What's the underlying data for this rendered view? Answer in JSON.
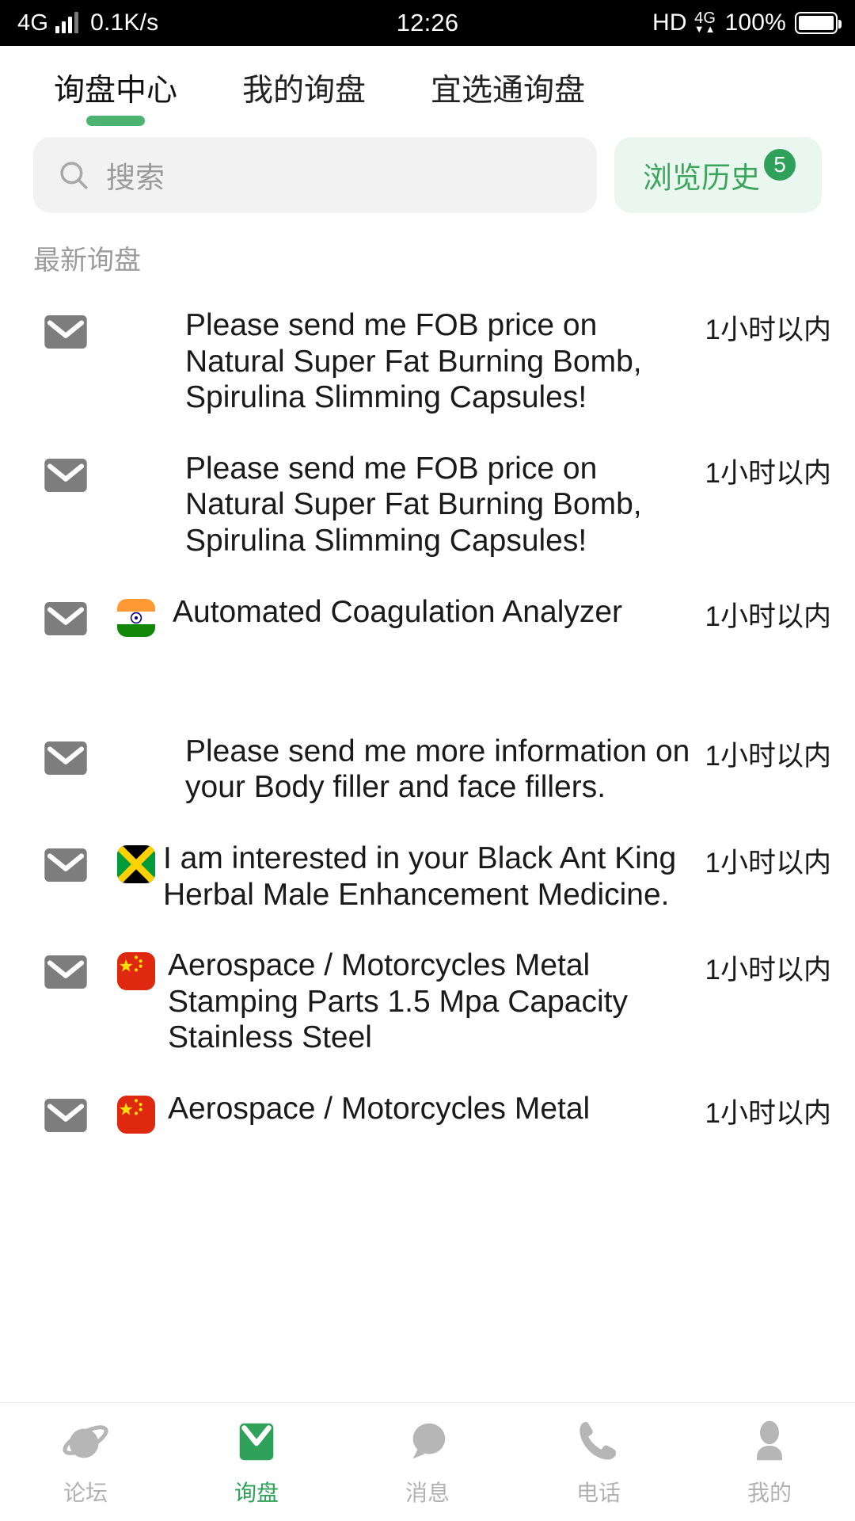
{
  "statusbar": {
    "network_type": "4G",
    "speed": "0.1K/s",
    "time": "12:26",
    "hd": "HD",
    "data_badge": "4G",
    "data_arrows": "▼▲",
    "battery_percent": "100%"
  },
  "tabs": {
    "items": [
      {
        "label": "询盘中心",
        "active": true
      },
      {
        "label": "我的询盘",
        "active": false
      },
      {
        "label": "宜选通询盘",
        "active": false
      }
    ],
    "active_underline_color": "#4cb370"
  },
  "search": {
    "placeholder": "搜索",
    "icon": "search-icon"
  },
  "history": {
    "label": "浏览历史",
    "badge": "5",
    "text_color": "#3ba55d",
    "badge_color": "#2fa15a",
    "background": "#eaf7ee"
  },
  "section": {
    "title": "最新询盘"
  },
  "list": {
    "rows": [
      {
        "icon": "mail-icon",
        "flag": null,
        "title": "Please send me FOB price on Natural Super Fat Burning Bomb, Spirulina Slimming Capsules!",
        "time": "1小时以内"
      },
      {
        "icon": "mail-icon",
        "flag": null,
        "title": "Please send me FOB price on Natural Super Fat Burning Bomb, Spirulina Slimming Capsules!",
        "time": "1小时以内"
      },
      {
        "icon": "mail-icon",
        "flag": "india-flag",
        "title": "Automated Coagulation Analyzer",
        "time": "1小时以内"
      },
      {
        "icon": "mail-icon",
        "flag": null,
        "title": "Please send me more information on your Body filler and face fillers.",
        "time": "1小时以内"
      },
      {
        "icon": "mail-icon",
        "flag": "jamaica-flag",
        "title": "I am interested in your Black Ant King Herbal Male Enhancement Medicine.",
        "time": "1小时以内"
      },
      {
        "icon": "mail-icon",
        "flag": "china-flag",
        "title": "Aerospace / Motorcycles Metal Stamping Parts 1.5 Mpa Capacity Stainless Steel",
        "time": "1小时以内"
      },
      {
        "icon": "mail-icon",
        "flag": "china-flag",
        "title": "Aerospace / Motorcycles Metal",
        "time": "1小时以内"
      }
    ]
  },
  "bottomnav": {
    "items": [
      {
        "label": "论坛",
        "icon": "planet-icon",
        "active": false
      },
      {
        "label": "询盘",
        "icon": "envelope-icon",
        "active": true
      },
      {
        "label": "消息",
        "icon": "chat-bubble-icon",
        "active": false
      },
      {
        "label": "电话",
        "icon": "phone-icon",
        "active": false
      },
      {
        "label": "我的",
        "icon": "person-icon",
        "active": false
      }
    ],
    "active_color": "#2fa15a",
    "inactive_color": "#b2b2b2"
  }
}
